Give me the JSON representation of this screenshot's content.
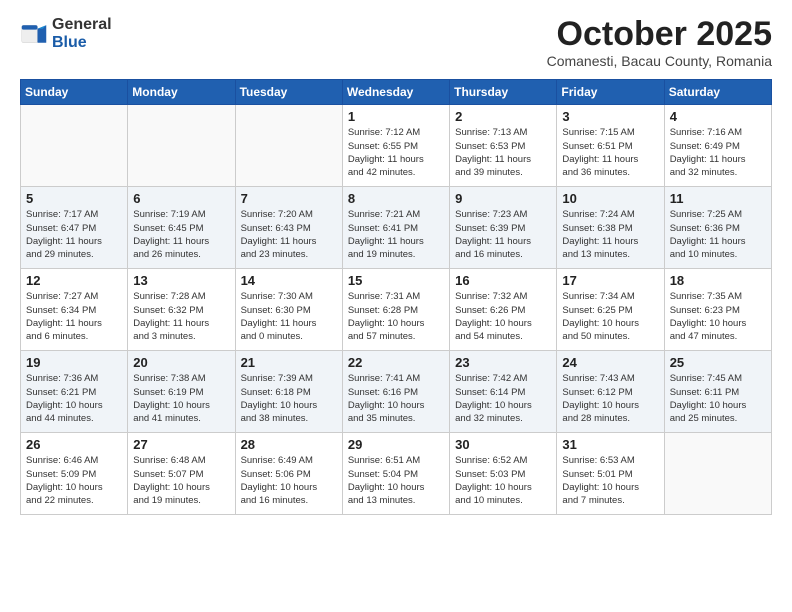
{
  "logo": {
    "general": "General",
    "blue": "Blue"
  },
  "title": "October 2025",
  "subtitle": "Comanesti, Bacau County, Romania",
  "headers": [
    "Sunday",
    "Monday",
    "Tuesday",
    "Wednesday",
    "Thursday",
    "Friday",
    "Saturday"
  ],
  "weeks": [
    [
      {
        "day": "",
        "info": ""
      },
      {
        "day": "",
        "info": ""
      },
      {
        "day": "",
        "info": ""
      },
      {
        "day": "1",
        "info": "Sunrise: 7:12 AM\nSunset: 6:55 PM\nDaylight: 11 hours\nand 42 minutes."
      },
      {
        "day": "2",
        "info": "Sunrise: 7:13 AM\nSunset: 6:53 PM\nDaylight: 11 hours\nand 39 minutes."
      },
      {
        "day": "3",
        "info": "Sunrise: 7:15 AM\nSunset: 6:51 PM\nDaylight: 11 hours\nand 36 minutes."
      },
      {
        "day": "4",
        "info": "Sunrise: 7:16 AM\nSunset: 6:49 PM\nDaylight: 11 hours\nand 32 minutes."
      }
    ],
    [
      {
        "day": "5",
        "info": "Sunrise: 7:17 AM\nSunset: 6:47 PM\nDaylight: 11 hours\nand 29 minutes."
      },
      {
        "day": "6",
        "info": "Sunrise: 7:19 AM\nSunset: 6:45 PM\nDaylight: 11 hours\nand 26 minutes."
      },
      {
        "day": "7",
        "info": "Sunrise: 7:20 AM\nSunset: 6:43 PM\nDaylight: 11 hours\nand 23 minutes."
      },
      {
        "day": "8",
        "info": "Sunrise: 7:21 AM\nSunset: 6:41 PM\nDaylight: 11 hours\nand 19 minutes."
      },
      {
        "day": "9",
        "info": "Sunrise: 7:23 AM\nSunset: 6:39 PM\nDaylight: 11 hours\nand 16 minutes."
      },
      {
        "day": "10",
        "info": "Sunrise: 7:24 AM\nSunset: 6:38 PM\nDaylight: 11 hours\nand 13 minutes."
      },
      {
        "day": "11",
        "info": "Sunrise: 7:25 AM\nSunset: 6:36 PM\nDaylight: 11 hours\nand 10 minutes."
      }
    ],
    [
      {
        "day": "12",
        "info": "Sunrise: 7:27 AM\nSunset: 6:34 PM\nDaylight: 11 hours\nand 6 minutes."
      },
      {
        "day": "13",
        "info": "Sunrise: 7:28 AM\nSunset: 6:32 PM\nDaylight: 11 hours\nand 3 minutes."
      },
      {
        "day": "14",
        "info": "Sunrise: 7:30 AM\nSunset: 6:30 PM\nDaylight: 11 hours\nand 0 minutes."
      },
      {
        "day": "15",
        "info": "Sunrise: 7:31 AM\nSunset: 6:28 PM\nDaylight: 10 hours\nand 57 minutes."
      },
      {
        "day": "16",
        "info": "Sunrise: 7:32 AM\nSunset: 6:26 PM\nDaylight: 10 hours\nand 54 minutes."
      },
      {
        "day": "17",
        "info": "Sunrise: 7:34 AM\nSunset: 6:25 PM\nDaylight: 10 hours\nand 50 minutes."
      },
      {
        "day": "18",
        "info": "Sunrise: 7:35 AM\nSunset: 6:23 PM\nDaylight: 10 hours\nand 47 minutes."
      }
    ],
    [
      {
        "day": "19",
        "info": "Sunrise: 7:36 AM\nSunset: 6:21 PM\nDaylight: 10 hours\nand 44 minutes."
      },
      {
        "day": "20",
        "info": "Sunrise: 7:38 AM\nSunset: 6:19 PM\nDaylight: 10 hours\nand 41 minutes."
      },
      {
        "day": "21",
        "info": "Sunrise: 7:39 AM\nSunset: 6:18 PM\nDaylight: 10 hours\nand 38 minutes."
      },
      {
        "day": "22",
        "info": "Sunrise: 7:41 AM\nSunset: 6:16 PM\nDaylight: 10 hours\nand 35 minutes."
      },
      {
        "day": "23",
        "info": "Sunrise: 7:42 AM\nSunset: 6:14 PM\nDaylight: 10 hours\nand 32 minutes."
      },
      {
        "day": "24",
        "info": "Sunrise: 7:43 AM\nSunset: 6:12 PM\nDaylight: 10 hours\nand 28 minutes."
      },
      {
        "day": "25",
        "info": "Sunrise: 7:45 AM\nSunset: 6:11 PM\nDaylight: 10 hours\nand 25 minutes."
      }
    ],
    [
      {
        "day": "26",
        "info": "Sunrise: 6:46 AM\nSunset: 5:09 PM\nDaylight: 10 hours\nand 22 minutes."
      },
      {
        "day": "27",
        "info": "Sunrise: 6:48 AM\nSunset: 5:07 PM\nDaylight: 10 hours\nand 19 minutes."
      },
      {
        "day": "28",
        "info": "Sunrise: 6:49 AM\nSunset: 5:06 PM\nDaylight: 10 hours\nand 16 minutes."
      },
      {
        "day": "29",
        "info": "Sunrise: 6:51 AM\nSunset: 5:04 PM\nDaylight: 10 hours\nand 13 minutes."
      },
      {
        "day": "30",
        "info": "Sunrise: 6:52 AM\nSunset: 5:03 PM\nDaylight: 10 hours\nand 10 minutes."
      },
      {
        "day": "31",
        "info": "Sunrise: 6:53 AM\nSunset: 5:01 PM\nDaylight: 10 hours\nand 7 minutes."
      },
      {
        "day": "",
        "info": ""
      }
    ]
  ]
}
